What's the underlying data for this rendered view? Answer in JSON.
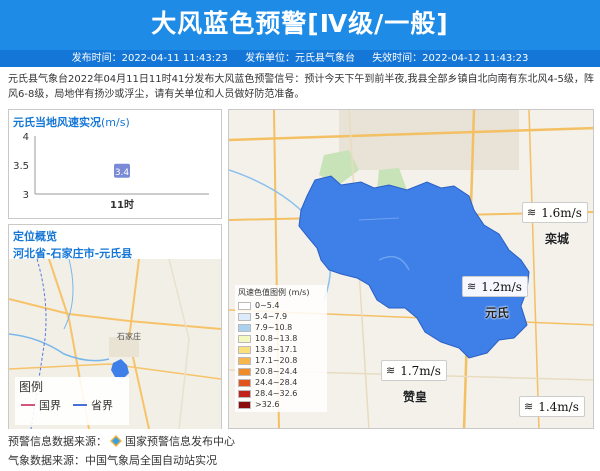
{
  "header": {
    "title": "大风蓝色预警[Ⅳ级/一般]",
    "issue_time": "发布时间：2022-04-11 11:43:23",
    "issuer": "发布单位：元氏县气象台",
    "expire_time": "失效时间：2022-04-12 11:43:23"
  },
  "description": "元氏县气象台2022年04月11日11时41分发布大风蓝色预警信号：预计今天下午到前半夜,我县全部乡镇自北向南有东北风4-5级，阵风6-8级，局地伴有扬沙或浮尘，请有关单位和人员做好防范准备。",
  "wind_panel": {
    "title": "元氏当地风速实况",
    "unit": "(m/s)"
  },
  "chart_data": {
    "type": "bar",
    "categories": [
      "11时"
    ],
    "values": [
      3.4
    ],
    "ylim": [
      3,
      4
    ],
    "yticks": [
      "3",
      "3.5",
      "4"
    ],
    "data_labels": [
      "3.4"
    ]
  },
  "location_panel": {
    "title": "定位概览",
    "path": "河北省-石家庄市-元氏县",
    "minimap_city": "石家庄",
    "legend_title": "图例",
    "legend_items": [
      "国界",
      "省界"
    ]
  },
  "wind_legend": {
    "title": "风速色值图例 (m/s)",
    "items": [
      {
        "label": "0~5.4",
        "color": "#ffffff"
      },
      {
        "label": "5.4~7.9",
        "color": "#dcebfa"
      },
      {
        "label": "7.9~10.8",
        "color": "#a9d1f2"
      },
      {
        "label": "10.8~13.8",
        "color": "#f4f9c0"
      },
      {
        "label": "13.8~17.1",
        "color": "#f9e07d"
      },
      {
        "label": "17.1~20.8",
        "color": "#f7b64c"
      },
      {
        "label": "20.8~24.4",
        "color": "#f08b2a"
      },
      {
        "label": "24.4~28.4",
        "color": "#e3531e"
      },
      {
        "label": "28.4~32.6",
        "color": "#c1221a"
      },
      {
        "label": ">32.6",
        "color": "#8a0c0c"
      }
    ]
  },
  "stations": [
    {
      "value": "1.6m/s"
    },
    {
      "value": "1.2m/s"
    },
    {
      "value": "1.7m/s"
    },
    {
      "value": "1.4m/s"
    }
  ],
  "cities": {
    "luancheng": "栾城",
    "yuanshi": "元氏",
    "zanhuang": "赞皇"
  },
  "footer": {
    "source_label": "预警信息数据来源：",
    "source_value": "国家预警信息发布中心",
    "weather_label": "气象数据来源：",
    "weather_value": "中国气象局全国自动站实况"
  },
  "colors": {
    "header_bg": "#1e8be6",
    "warning_area": "#3e7fe8",
    "title_blue": "#1476d6",
    "bar": "#7a8ad6"
  }
}
